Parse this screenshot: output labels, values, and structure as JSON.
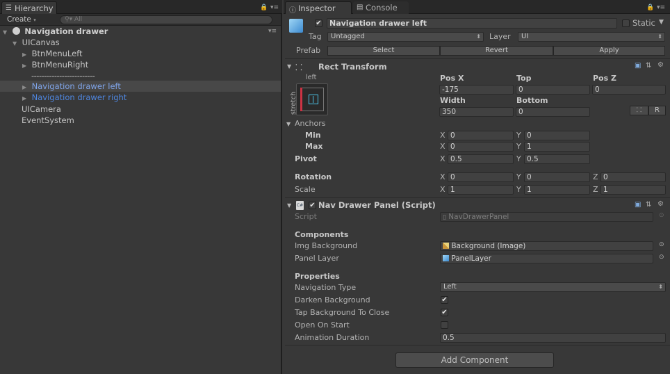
{
  "colors": {
    "selected_row_bg": "#484848",
    "prefab_blue": "#7fa4e8",
    "accent_blue": "#4e86e0"
  },
  "hierarchy": {
    "tab": "Hierarchy",
    "create": "Create",
    "search_placeholder": "All",
    "scene": "Navigation drawer",
    "items": [
      {
        "label": "UICanvas"
      },
      {
        "label": "BtnMenuLeft"
      },
      {
        "label": "BtnMenuRight"
      },
      {
        "label": "-------------------------"
      },
      {
        "label": "Navigation drawer left"
      },
      {
        "label": "Navigation drawer right"
      },
      {
        "label": "UICamera"
      },
      {
        "label": "EventSystem"
      }
    ]
  },
  "inspector": {
    "tab": "Inspector",
    "console_tab": "Console",
    "object_name": "Navigation drawer left",
    "static_label": "Static",
    "tag_label": "Tag",
    "tag_value": "Untagged",
    "layer_label": "Layer",
    "layer_value": "UI",
    "prefab_label": "Prefab",
    "prefab_buttons": [
      "Select",
      "Revert",
      "Apply"
    ],
    "rect": {
      "title": "Rect Transform",
      "anchor_h": "left",
      "anchor_v": "stretch",
      "col1": "Pos X",
      "col2": "Top",
      "col3": "Pos Z",
      "posx": "-175",
      "top": "0",
      "posz": "0",
      "col4": "Width",
      "col5": "Bottom",
      "width": "350",
      "bottom": "0",
      "r_btn": "R",
      "anchors": "Anchors",
      "min": "Min",
      "max": "Max",
      "min_x": "0",
      "min_y": "0",
      "max_x": "0",
      "max_y": "1",
      "pivot": "Pivot",
      "pivot_x": "0.5",
      "pivot_y": "0.5",
      "rotation": "Rotation",
      "rot_x": "0",
      "rot_y": "0",
      "rot_z": "0",
      "scale": "Scale",
      "scale_x": "1",
      "scale_y": "1",
      "scale_z": "1",
      "x": "X",
      "y": "Y",
      "z": "Z"
    },
    "script_comp": {
      "title": "Nav Drawer Panel (Script)",
      "script_label": "Script",
      "script_value": "NavDrawerPanel",
      "components_header": "Components",
      "img_bg_label": "Img Background",
      "img_bg_value": "Background (Image)",
      "panel_layer_label": "Panel Layer",
      "panel_layer_value": "PanelLayer",
      "properties_header": "Properties",
      "nav_type_label": "Navigation Type",
      "nav_type_value": "Left",
      "darken_label": "Darken Background",
      "darken_checked": true,
      "tap_label": "Tap Background To Close",
      "tap_checked": true,
      "open_label": "Open On Start",
      "open_checked": false,
      "anim_label": "Animation Duration",
      "anim_value": "0.5"
    },
    "add_component": "Add Component"
  }
}
